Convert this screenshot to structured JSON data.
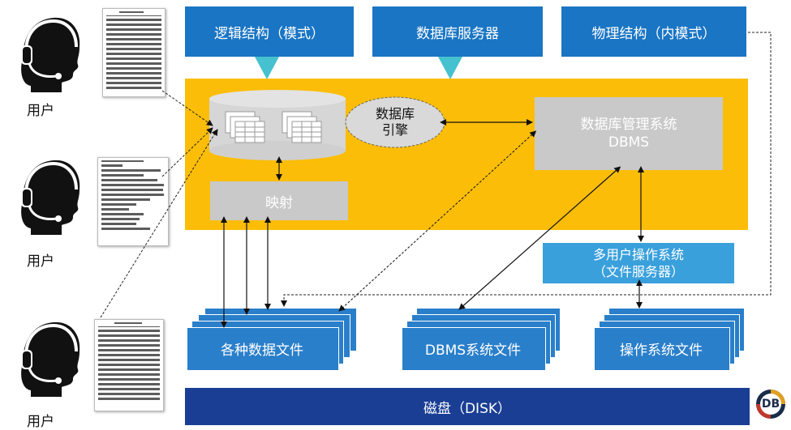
{
  "top_boxes": {
    "logical": "逻辑结构（模式）",
    "db_server": "数据库服务器",
    "physical": "物理结构（内模式）"
  },
  "engine_label": [
    "数据库",
    "引擎"
  ],
  "dbms_label": [
    "数据库管理系统",
    "DBMS"
  ],
  "mapping_label": "映射",
  "multi_user_os": [
    "多用户操作系统",
    "（文件服务器）"
  ],
  "file_groups": {
    "data_files": "各种数据文件",
    "dbms_files": "DBMS系统文件",
    "os_files": "操作系统文件"
  },
  "disk_label": "磁盘（DISK）",
  "users": [
    "用户",
    "用户",
    "用户"
  ],
  "logo_text": "DB",
  "colors": {
    "blue_box": "#1a75c4",
    "light_blue": "#3aa0dc",
    "yellow": "#fbbd08",
    "gray": "#c9c9c9",
    "disk": "#1a3e94",
    "teal_arrow": "#45c1cf"
  },
  "icons": [
    "headset-user-icon",
    "table-icon",
    "database-cylinder-icon",
    "db-logo-icon"
  ]
}
